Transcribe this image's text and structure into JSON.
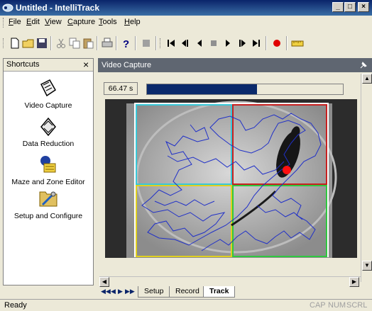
{
  "window": {
    "title": "Untitled - IntelliTrack",
    "controls": {
      "minimize": "_",
      "maximize": "□",
      "close": "×"
    }
  },
  "menu": {
    "items": [
      "File",
      "Edit",
      "View",
      "Capture",
      "Tools",
      "Help"
    ]
  },
  "toolbar": {
    "icons": [
      "new-icon",
      "open-icon",
      "save-icon",
      "cut-icon",
      "copy-icon",
      "paste-icon",
      "print-icon",
      "help-icon",
      "stop-capture-icon",
      "skip-start-icon",
      "step-back-icon",
      "play-back-icon",
      "stop-icon",
      "play-icon",
      "step-forward-icon",
      "skip-end-icon",
      "record-icon",
      "ruler-icon"
    ]
  },
  "shortcuts": {
    "title": "Shortcuts",
    "close": "×",
    "items": [
      {
        "label": "Video Capture",
        "icon": "video-capture-icon"
      },
      {
        "label": "Data Reduction",
        "icon": "data-reduction-icon"
      },
      {
        "label": "Maze and Zone Editor",
        "icon": "maze-editor-icon"
      },
      {
        "label": "Setup and Configure",
        "icon": "setup-configure-icon"
      }
    ]
  },
  "video_capture": {
    "title": "Video Capture",
    "time": "66.47 s",
    "progress_fraction": 0.56,
    "zones": [
      {
        "name": "zone-top-left",
        "color": "#38c8d8"
      },
      {
        "name": "zone-top-right",
        "color": "#c82020"
      },
      {
        "name": "zone-bottom-left",
        "color": "#e0d020"
      },
      {
        "name": "zone-bottom-right",
        "color": "#30c840"
      }
    ],
    "track_color": "#2030c8",
    "marker_color": "#ff1010"
  },
  "tabs": {
    "items": [
      "Setup",
      "Record",
      "Track"
    ],
    "active": "Track"
  },
  "status": {
    "text": "Ready",
    "indicators": [
      "CAP",
      "NUM",
      "SCRL"
    ]
  }
}
